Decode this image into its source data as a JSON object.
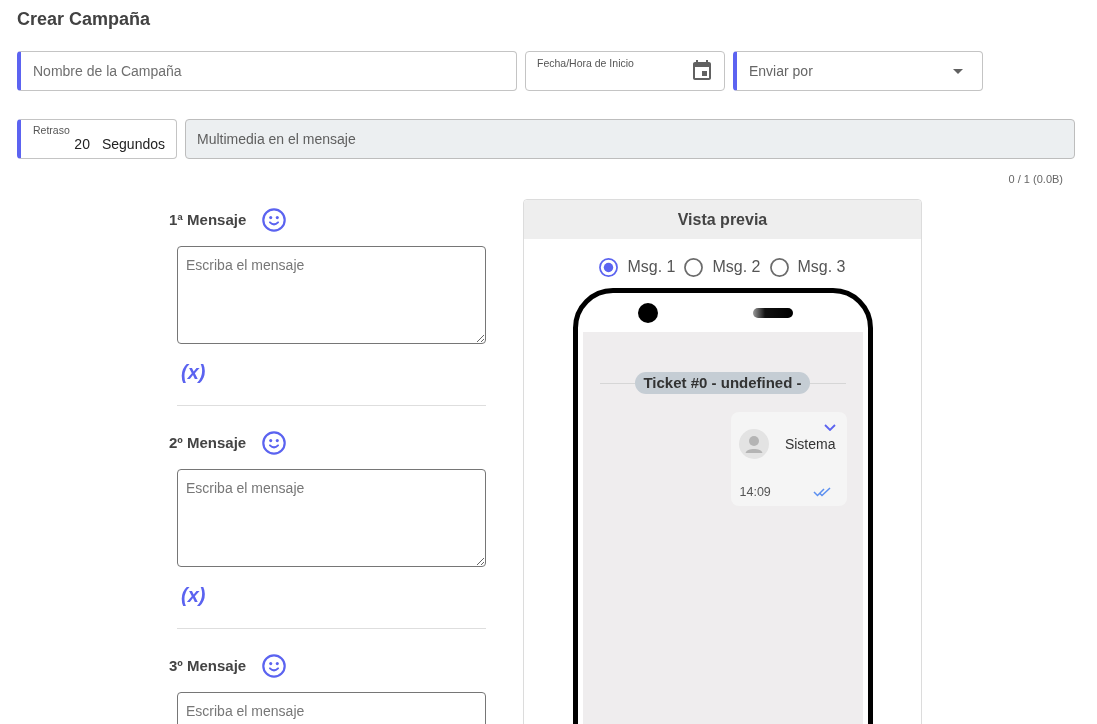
{
  "title": "Crear Campaña",
  "top_fields": [
    {
      "kind": "text",
      "placeholder": "Nombre de la Campaña",
      "accent_bar": true
    },
    {
      "kind": "datetime",
      "label": "Fecha/Hora de Inicio",
      "accent_bar": false
    },
    {
      "kind": "select",
      "placeholder": "Enviar por",
      "accent_bar": true
    }
  ],
  "second_fields": [
    {
      "kind": "delay",
      "label": "Retraso",
      "value": "20",
      "unit": "Segundos",
      "accent_bar": true
    },
    {
      "kind": "media",
      "placeholder": "Multimedia en el mensaje",
      "accent_bar": false
    }
  ],
  "media_counter": "0 / 1 (0.0B)",
  "messages": [
    {
      "title": "1ª Mensaje",
      "placeholder": "Escriba el mensaje",
      "variable_button": "(x)"
    },
    {
      "title": "2º Mensaje",
      "placeholder": "Escriba el mensaje",
      "variable_button": "(x)"
    },
    {
      "title": "3º Mensaje",
      "placeholder": "Escriba el mensaje"
    }
  ],
  "preview": {
    "title": "Vista previa",
    "options": [
      {
        "label": "Msg. 1",
        "selected": true
      },
      {
        "label": "Msg. 2",
        "selected": false
      },
      {
        "label": "Msg. 3",
        "selected": false
      }
    ],
    "ticket": "Ticket #0 - undefined -",
    "message": {
      "sender": "Sistema",
      "time": "14:09"
    }
  }
}
